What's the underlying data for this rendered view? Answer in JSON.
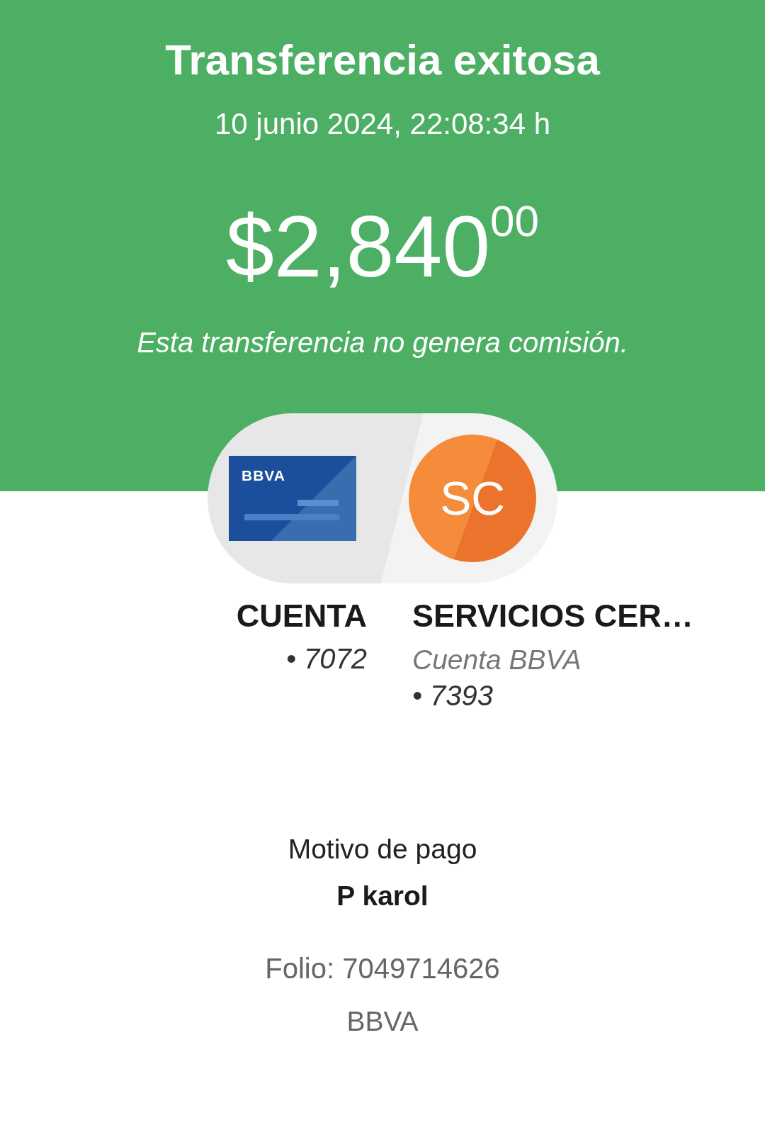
{
  "header": {
    "title": "Transferencia exitosa",
    "datetime": "10 junio 2024, 22:08:34 h",
    "amount": "$2,840$^{00}$",
    "note": "Esta transferencia no genera comisión."
  },
  "origin": {
    "card_brand": "BBVA",
    "name": "CUENTA",
    "account": "• 7072"
  },
  "destination": {
    "initials": "SC",
    "name": "SERVICIOS CER…",
    "bank": "Cuenta BBVA",
    "account": "• 7393"
  },
  "payment_reason": {
    "label": "Motivo de pago",
    "value": "P karol"
  },
  "folio": "Folio: 7049714626",
  "footer": "BBVA"
}
